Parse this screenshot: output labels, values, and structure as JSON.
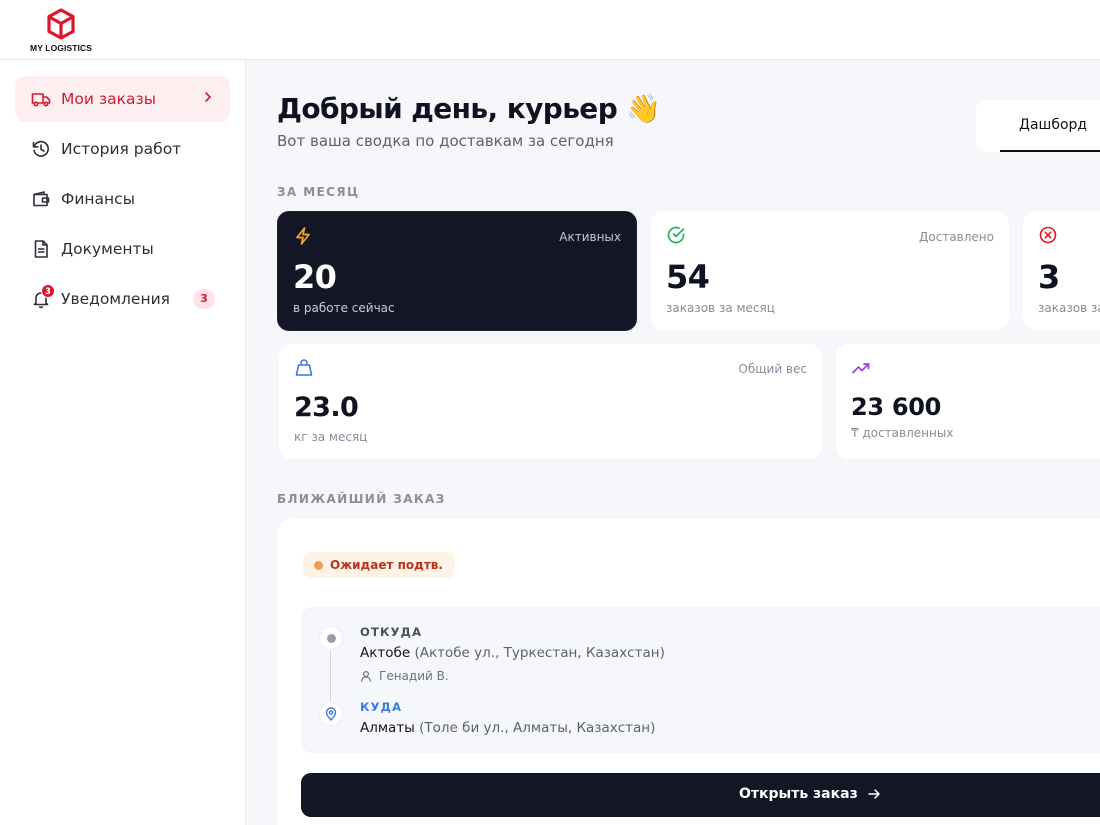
{
  "brand": {
    "name": "MY LOGISTICS",
    "accent": "#e0142b"
  },
  "sidebar": {
    "items": [
      {
        "label": "Мои заказы",
        "icon": "truck-icon",
        "active": true
      },
      {
        "label": "История работ",
        "icon": "history-icon"
      },
      {
        "label": "Финансы",
        "icon": "wallet-icon"
      },
      {
        "label": "Документы",
        "icon": "document-icon"
      },
      {
        "label": "Уведомления",
        "icon": "bell-icon",
        "badge": "3"
      }
    ]
  },
  "header": {
    "greeting": "Добрый день, курьер 👋",
    "subtitle": "Вот ваша сводка по доставкам за сегодня"
  },
  "tabs": [
    {
      "label": "Дашборд",
      "active": true
    }
  ],
  "stats": {
    "section_label": "ЗА МЕСЯЦ",
    "cards": [
      {
        "label": "Активных",
        "value": "20",
        "sub": "в работе сейчас",
        "icon": "lightning-icon",
        "color": "#f5a623"
      },
      {
        "label": "Доставлено",
        "value": "54",
        "sub": "заказов за месяц",
        "icon": "check-circle-icon",
        "color": "#22b35e"
      },
      {
        "label": "",
        "value": "3",
        "sub": "заказов за м",
        "icon": "x-circle-icon",
        "color": "#e0142b"
      },
      {
        "label": "Общий вес",
        "value": "23.0",
        "sub": "кг за месяц",
        "icon": "weight-icon",
        "color": "#3b7be0"
      },
      {
        "label": "",
        "value": "23 600",
        "sub": "₸ доставленных",
        "icon": "trending-up-icon",
        "color": "#9b3fe8"
      }
    ]
  },
  "nearest": {
    "section_label": "БЛИЖАЙШИЙ ЗАКАЗ",
    "status": "Ожидает подтв.",
    "from": {
      "heading": "ОТКУДА",
      "city": "Актобе",
      "address": "(Актобе ул., Туркестан, Казахстан)",
      "person": "Генадий В."
    },
    "to": {
      "heading": "КУДА",
      "city": "Алматы",
      "address": "(Толе би ул., Алматы, Казахстан)"
    },
    "button": "Открыть заказ"
  }
}
